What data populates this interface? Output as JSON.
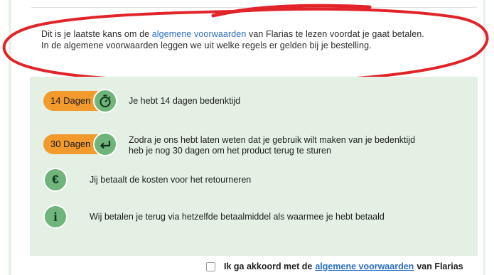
{
  "notice": {
    "line1_before": "Dit is je laatste kans om de",
    "line1_link": "algemene voorwaarden",
    "line1_after": "van Flarias te lezen voordat je gaat betalen.",
    "line2": "In de algemene voorwaarden leggen we uit welke regels er gelden bij je bestelling."
  },
  "features": [
    {
      "badge": "14 Dagen",
      "icon": "stopwatch-icon",
      "text": "Je hebt 14 dagen bedenktijd"
    },
    {
      "badge": "30 Dagen",
      "icon": "return-arrow-icon",
      "text_line1": "Zodra je ons hebt laten weten dat je gebruik wilt maken van je bedenktijd",
      "text_line2": "heb je nog 30 dagen om het product terug te sturen"
    },
    {
      "icon": "euro-icon",
      "glyph": "€",
      "text": "Jij betaalt de kosten voor het retourneren"
    },
    {
      "icon": "info-icon",
      "glyph": "i",
      "text": "Wij betalen je terug via hetzelfde betaalmiddel als waarmee je hebt betaald"
    }
  ],
  "consent": {
    "before": "Ik ga akkoord met de",
    "link": "algemene voorwaarden",
    "after": "van Flarias",
    "checked": false
  },
  "colors": {
    "badge": "#f39a2c",
    "icon_circle": "#6fb47a",
    "link": "#2a6fc7",
    "highlight_oval": "#e0242a",
    "panel_green": "#e3f0e3"
  }
}
